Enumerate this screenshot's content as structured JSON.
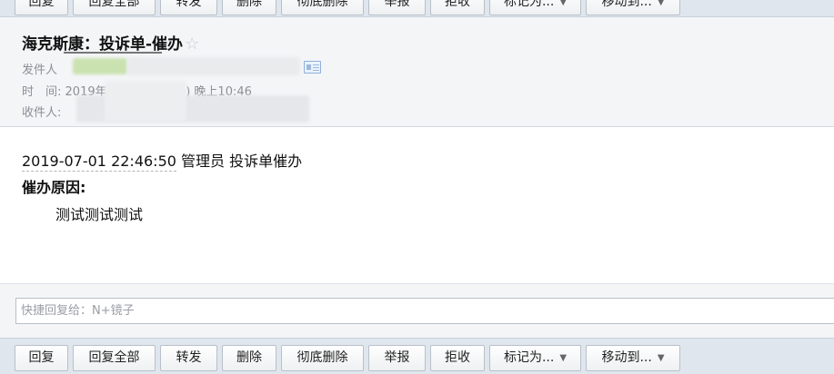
{
  "toolbar": {
    "buttons": [
      {
        "label": "回复"
      },
      {
        "label": "回复全部"
      },
      {
        "label": "转发"
      },
      {
        "label": "删除"
      },
      {
        "label": "彻底删除"
      },
      {
        "label": "举报"
      },
      {
        "label": "拒收"
      },
      {
        "label": "标记为..."
      },
      {
        "label": "移动到..."
      }
    ],
    "dropdown_arrow": "▼"
  },
  "mail": {
    "subject": "海克斯康：投诉单-催办",
    "star_icon": "☆",
    "sender_label": "发件人",
    "time_label": "时　间:",
    "time_value": "2019年7月1日(星期一) 晚上10:46",
    "recipient_label": "收件人:"
  },
  "content": {
    "datetime": "2019-07-01 22:46:50",
    "author_action": "管理员 投诉单催办",
    "reason_label": "催办原因:",
    "reason_text": "测试测试测试"
  },
  "quick_reply": {
    "placeholder": "快捷回复给：N+镜子"
  },
  "colors": {
    "toolbar_bg": "#dfe6ee",
    "header_bg": "#f4f5f7",
    "meta_text": "#8a8f96"
  }
}
